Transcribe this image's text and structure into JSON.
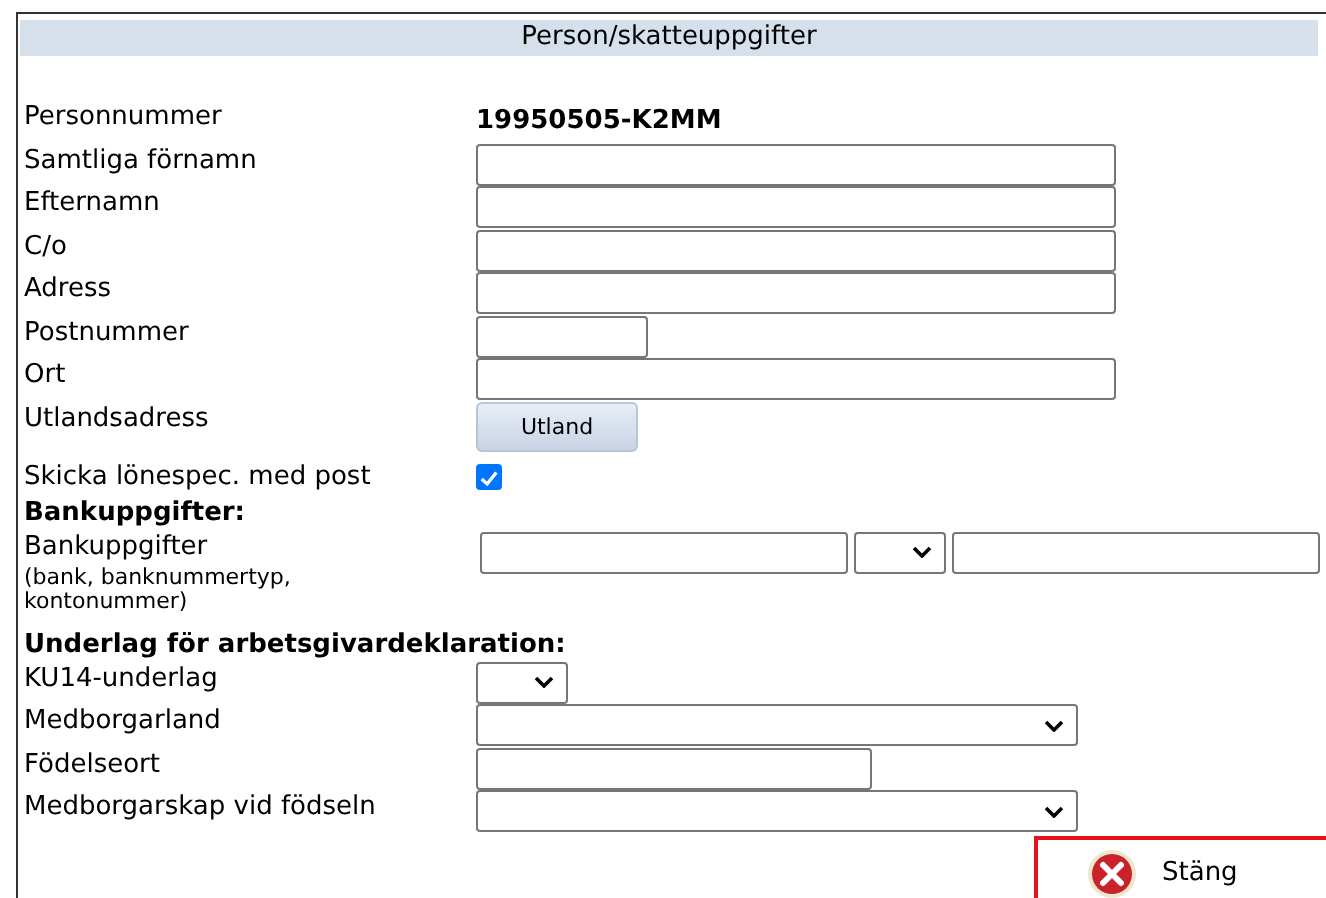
{
  "panel_title": "Person/skatteuppgifter",
  "rows": [
    {
      "kind": "value",
      "label": "Personnummer",
      "value": "19950505-K2MM"
    },
    {
      "kind": "text",
      "label": "Samtliga förnamn"
    },
    {
      "kind": "text",
      "label": "Efternamn"
    },
    {
      "kind": "text",
      "label": "C/o"
    },
    {
      "kind": "text",
      "label": "Adress"
    },
    {
      "kind": "text",
      "label": "Postnummer"
    },
    {
      "kind": "text",
      "label": "Ort"
    },
    {
      "kind": "button",
      "label": "Utlandsadress",
      "button": "Utland"
    },
    {
      "kind": "checkbox",
      "label": "Skicka lönespec. med post",
      "checked": true
    },
    {
      "kind": "heading",
      "label": "Bankuppgifter:"
    },
    {
      "kind": "bank",
      "label": "Bankuppgifter",
      "note": "(bank, banknummertyp, kontonummer)"
    },
    {
      "kind": "heading",
      "label": "Underlag för arbetsgivardeklaration:"
    },
    {
      "kind": "select",
      "label": "KU14-underlag"
    },
    {
      "kind": "select",
      "label": "Medborgarland"
    },
    {
      "kind": "text",
      "label": "Födelseort"
    },
    {
      "kind": "select",
      "label": "Medborgarskap vid födseln"
    }
  ],
  "close_button": "Stäng"
}
